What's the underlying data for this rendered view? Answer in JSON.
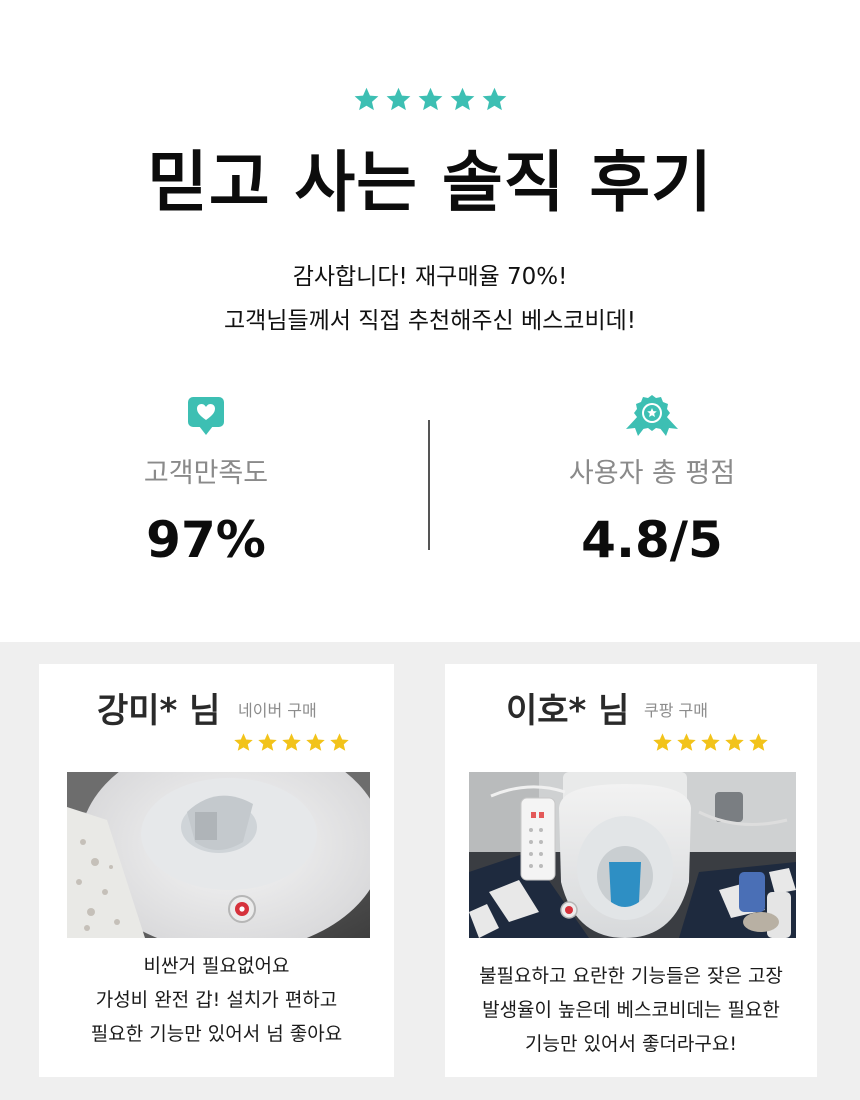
{
  "colors": {
    "accent": "#3dbfb3",
    "star_gold": "#f2c31a",
    "review_bg": "#efefef"
  },
  "hero": {
    "title": "믿고 사는 솔직 후기",
    "subtitle_line1": "감사합니다! 재구매율 70%!",
    "subtitle_line2": "고객님들께서 직접 추천해주신 베스코비데!",
    "star_count": 5
  },
  "stats": {
    "satisfaction": {
      "icon": "heart-speech-bubble-icon",
      "label": "고객만족도",
      "value": "97%"
    },
    "rating": {
      "icon": "award-ribbon-icon",
      "label": "사용자 총 평점",
      "value": "4.8/5"
    }
  },
  "reviews": [
    {
      "name": "강미* 님",
      "source": "네이버 구매",
      "stars": 5,
      "photo": "toilet-bidet-closeup-photo",
      "lines": [
        "비싼거 필요없어요",
        "가성비 완전 갑! 설치가 편하고",
        "필요한 기능만 있어서 넘 좋아요"
      ]
    },
    {
      "name": "이호* 님",
      "source": "쿠팡 구매",
      "stars": 5,
      "photo": "installed-bidet-bathroom-photo",
      "lines": [
        "불필요하고 요란한 기능들은 잦은 고장",
        "발생율이 높은데 베스코비데는 필요한",
        "기능만 있어서 좋더라구요!"
      ]
    }
  ]
}
